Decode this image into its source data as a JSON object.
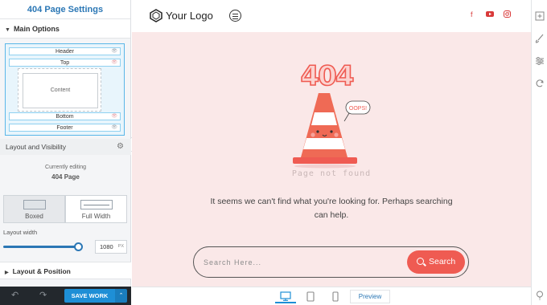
{
  "sidebar": {
    "title": "404 Page Settings",
    "main_options_label": "Main Options",
    "layout_rows": {
      "header": "Header",
      "top": "Top",
      "content": "Content",
      "bottom": "Bottom",
      "footer": "Footer"
    },
    "layout_visibility_label": "Layout and Visibility",
    "currently_editing_label": "Currently editing",
    "editing_page": "404 Page",
    "width_options": [
      "Boxed",
      "Full Width"
    ],
    "selected_width_option": "Boxed",
    "layout_width_label": "Layout width",
    "layout_width_value": "1080",
    "layout_width_unit": "PX",
    "layout_width_fraction": 0.95,
    "layout_position_label": "Layout & Position",
    "save_label": "SAVE WORK"
  },
  "site": {
    "logo_text": "Your Logo",
    "social_icons": [
      "facebook-icon",
      "youtube-icon",
      "instagram-icon"
    ],
    "oops_text": "OOPS!",
    "not_found_text": "Page not found",
    "message": "It seems we can't find what you're looking for. Perhaps searching can help.",
    "search_placeholder": "Search Here...",
    "search_button": "Search"
  },
  "devicebar": {
    "devices": [
      "desktop-icon",
      "tablet-icon",
      "mobile-icon"
    ],
    "active_device": "desktop",
    "preview_label": "Preview"
  },
  "rail": {
    "icons": [
      "add-block-icon",
      "brush-icon",
      "sliders-icon",
      "refresh-icon",
      "help-icon"
    ]
  },
  "colors": {
    "accent": "#1e8fd6",
    "brand_red": "#ef5b52",
    "preview_bg": "#fae8e8"
  }
}
